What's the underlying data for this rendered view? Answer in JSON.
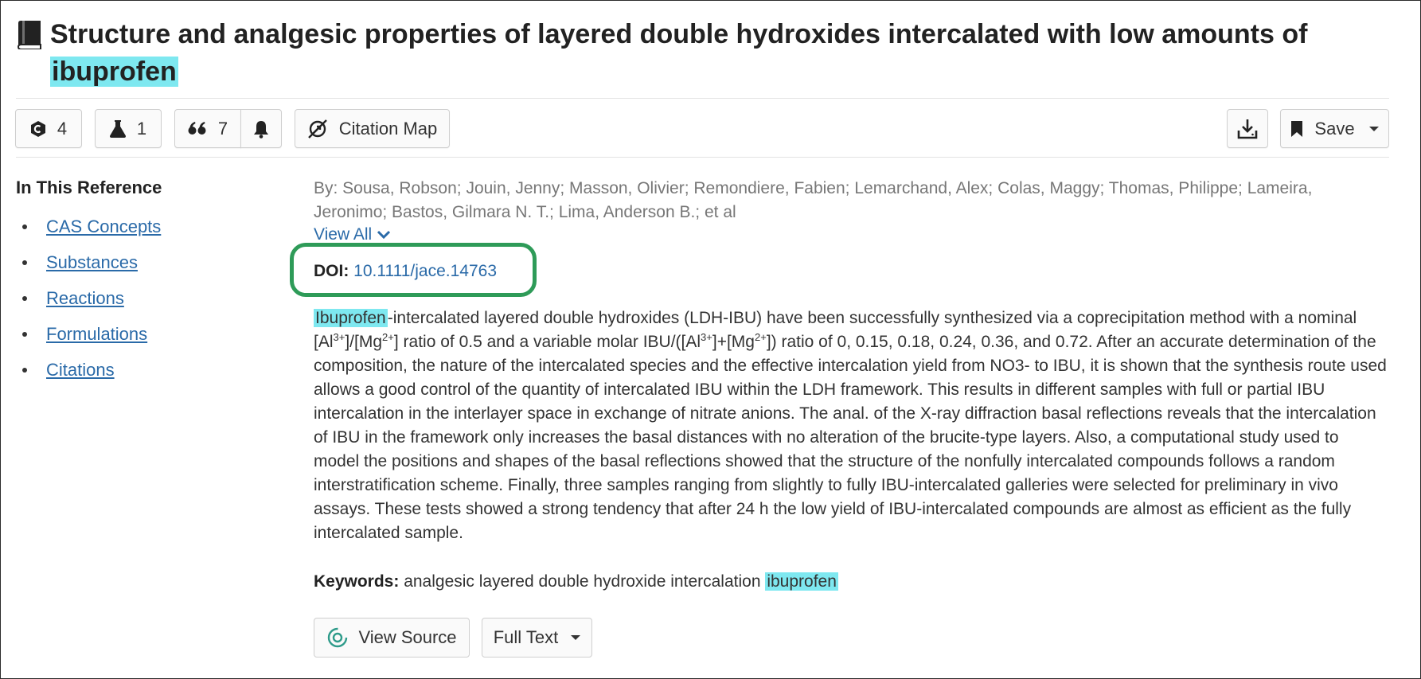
{
  "title": {
    "prefix": "Structure and analgesic properties of layered double hydroxides intercalated with low amounts of ",
    "highlight": "ibuprofen"
  },
  "toolbar": {
    "substances_count": "4",
    "reactions_count": "1",
    "citations_count": "7",
    "citation_map_label": "Citation Map",
    "save_label": "Save"
  },
  "sidebar": {
    "heading": "In This Reference",
    "items": [
      {
        "label": "CAS Concepts"
      },
      {
        "label": "Substances"
      },
      {
        "label": "Reactions"
      },
      {
        "label": "Formulations"
      },
      {
        "label": "Citations"
      }
    ]
  },
  "authors": {
    "text": "By: Sousa, Robson; Jouin, Jenny; Masson, Olivier; Remondiere, Fabien; Lemarchand, Alex; Colas, Maggy; Thomas, Philippe; Lameira, Jeronimo; Bastos, Gilmara N. T.; Lima, Anderson B.; et al",
    "view_all_label": "View All"
  },
  "doi": {
    "label": "DOI:",
    "value": "10.1111/jace.14763"
  },
  "abstract": {
    "highlight": "Ibuprofen",
    "p1": "-intercalated layered double hydroxides (LDH-IBU) have been successfully synthesized via a coprecipitation method with a nominal [Al",
    "sup1": "3+",
    "p2": "]/[Mg",
    "sup2": "2+",
    "p3": "] ratio of 0.5 and a variable molar IBU/([Al",
    "sup3": "3+",
    "p4": "]+[Mg",
    "sup4": "2+",
    "p5": "]) ratio of 0, 0.15, 0.18, 0.24, 0.36, and 0.72. After an accurate determination of the composition, the nature of the intercalated species and the effective intercalation yield from NO3- to IBU, it is shown that the synthesis route used allows a good control of the quantity of intercalated IBU within the LDH framework. This results in different samples with full or partial IBU intercalation in the interlayer space in exchange of nitrate anions. The anal. of the X-ray diffraction basal reflections reveals that the intercalation of IBU in the framework only increases the basal distances with no alteration of the brucite-type layers. Also, a computational study used to model the positions and shapes of the basal reflections showed that the structure of the nonfully intercalated compounds follows a random interstratification scheme. Finally, three samples ranging from slightly to fully IBU-intercalated galleries were selected for preliminary in vivo assays. These tests showed a strong tendency that after 24 h the low yield of IBU-intercalated compounds are almost as efficient as the fully intercalated sample."
  },
  "keywords": {
    "label": "Keywords:",
    "text": "analgesic layered double hydroxide intercalation ",
    "highlight": "ibuprofen"
  },
  "actions": {
    "view_source_label": "View Source",
    "full_text_label": "Full Text"
  },
  "colors": {
    "link": "#2a6aa8",
    "highlight": "#7ee8f0",
    "doi_ring": "#2e9b58"
  }
}
